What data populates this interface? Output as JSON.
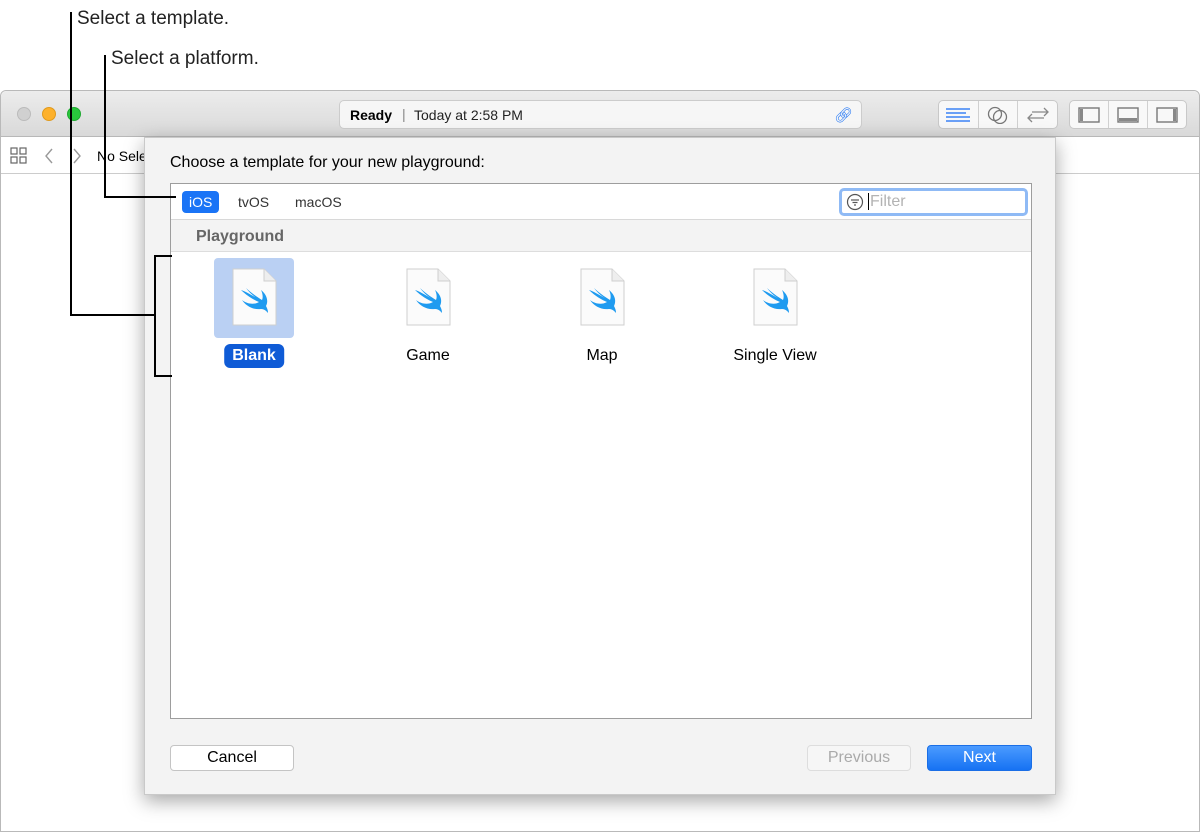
{
  "callouts": {
    "template": "Select a template.",
    "platform": "Select a platform."
  },
  "window": {
    "status": "Ready",
    "time": "Today at 2:58 PM",
    "jump": "No Selection"
  },
  "sheet": {
    "title": "Choose a template for your new playground:",
    "platforms": [
      {
        "label": "iOS",
        "selected": true
      },
      {
        "label": "tvOS"
      },
      {
        "label": "macOS"
      }
    ],
    "filter_placeholder": "Filter",
    "section": "Playground",
    "templates": [
      {
        "label": "Blank",
        "selected": true
      },
      {
        "label": "Game"
      },
      {
        "label": "Map"
      },
      {
        "label": "Single View"
      }
    ],
    "cancel": "Cancel",
    "previous": "Previous",
    "next": "Next"
  },
  "colors": {
    "accent": "#1a74f6",
    "selection": "#0f5bd6",
    "swift": "#1f9bf0"
  }
}
